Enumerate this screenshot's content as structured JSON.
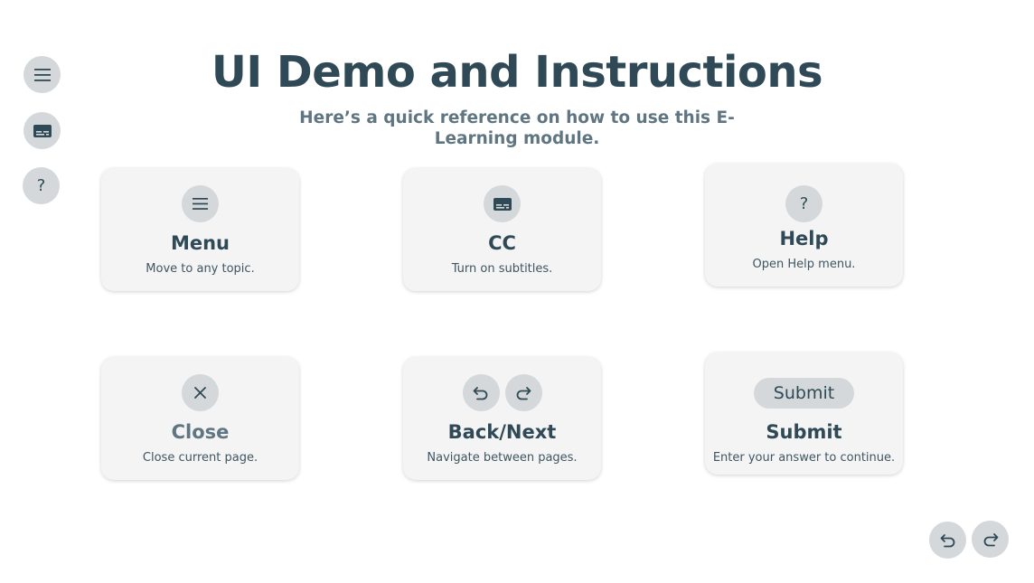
{
  "page": {
    "title": "UI Demo and Instructions",
    "subtitle": "Here’s a quick reference on how to use this E-Learning module."
  },
  "sidebar": {
    "menu_icon": "menu-icon",
    "cc_icon": "closed-captions-icon",
    "help_label": "?"
  },
  "cards": [
    {
      "title": "Menu",
      "desc": "Move to any topic.",
      "icon": "menu-icon"
    },
    {
      "title": "CC",
      "desc": "Turn on subtitles.",
      "icon": "closed-captions-icon"
    },
    {
      "title": "Help",
      "desc": "Open Help menu.",
      "icon_label": "?"
    },
    {
      "title": "Close",
      "desc": "Close current page.",
      "icon": "close-icon"
    },
    {
      "title": "Back/Next",
      "desc": "Navigate between pages.",
      "icons": [
        "back-arrow-icon",
        "next-arrow-icon"
      ]
    },
    {
      "title": "Submit",
      "desc": "Enter your answer to continue.",
      "button_label": "Submit"
    }
  ],
  "nav": {
    "back_icon": "back-arrow-icon",
    "next_icon": "next-arrow-icon"
  },
  "colors": {
    "primary_text": "#2f4a56",
    "muted_text": "#5f7682",
    "button_bg": "#d4d8da",
    "card_bg": "#f4f4f4"
  }
}
